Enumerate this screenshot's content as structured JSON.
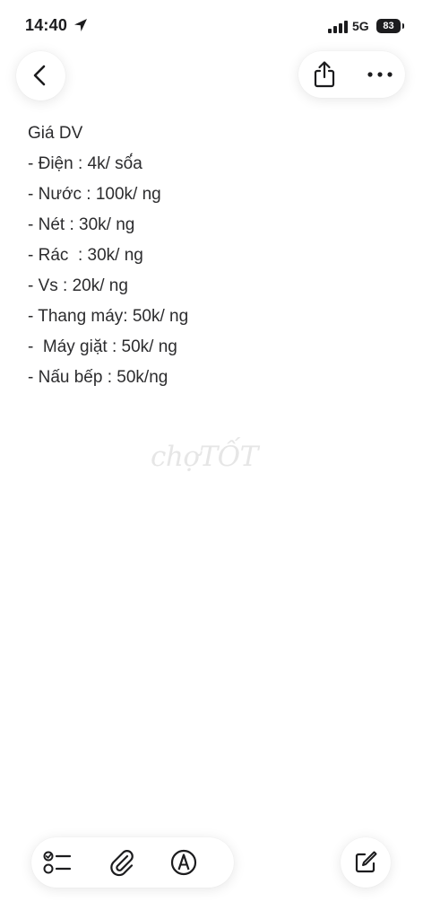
{
  "status_bar": {
    "time": "14:40",
    "network": "5G",
    "battery": "83"
  },
  "icons": {
    "back": "chevron-left-icon",
    "share": "share-icon",
    "more": "ellipsis-icon",
    "checklist": "checklist-icon",
    "attach": "paperclip-icon",
    "markup": "markup-pen-icon",
    "compose": "compose-icon"
  },
  "note": {
    "lines": [
      "Giá DV",
      "- Điện : 4k/ số́a",
      "- Nước : 100k/ ng",
      "- Nét : 30k/ ng",
      "- Rác  : 30k/ ng",
      "- Vs : 20k/ ng",
      "- Thang máy: 50k/ ng",
      "-  Máy giặt : 50k/ ng",
      "- Nấu bếp : 50k/ng"
    ]
  },
  "watermark": "chợTỐT"
}
